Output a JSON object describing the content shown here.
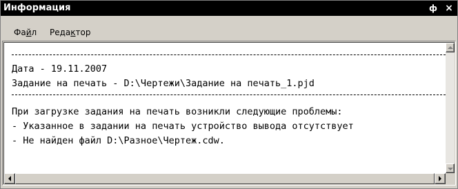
{
  "window": {
    "title": "Информация",
    "pin_glyph": "ф",
    "close_glyph": "×"
  },
  "menu": {
    "file": {
      "pre": "Фа",
      "accel": "й",
      "post": "л"
    },
    "edit": {
      "pre": "Реда",
      "accel": "к",
      "post": "тор"
    }
  },
  "content": {
    "date_line": "Дата - 19.11.2007",
    "task_line": "Задание на печать - D:\\Чертежи\\Задание на печать_1.pjd",
    "problems_header": "При загрузке задания на печать возникли следующие проблемы:",
    "problem_1": "- Указанное в задании на печать устройство вывода отсутствует",
    "problem_2": "- Не найден файл D:\\Разное\\Чертеж.cdw."
  }
}
